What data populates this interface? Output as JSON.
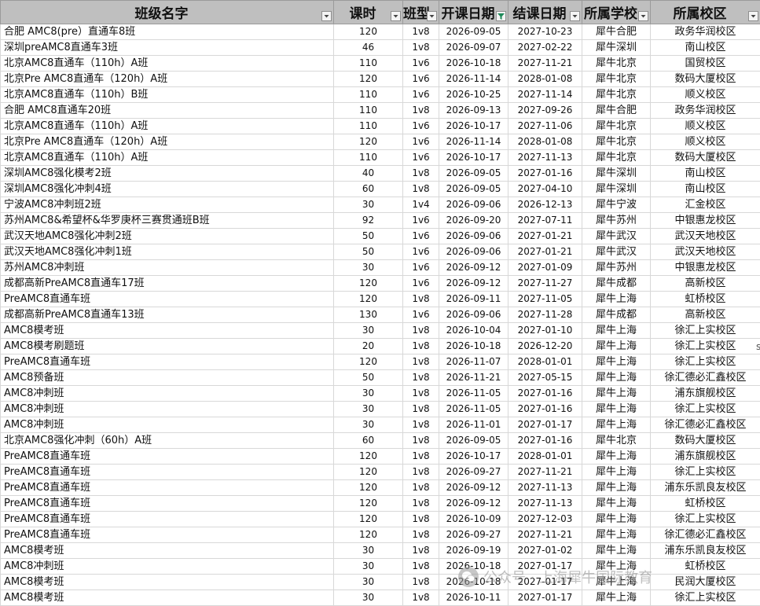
{
  "headers": [
    "班级名字",
    "课时",
    "班型",
    "开课日期",
    "结课日期",
    "所属学校",
    "所属校区"
  ],
  "header_filter_active": [
    false,
    false,
    false,
    true,
    false,
    false,
    false
  ],
  "colors": {
    "header_bg": "#bfbfbf",
    "grid": "#d8d8d8",
    "filter_active": "#1f8a5a"
  },
  "rows": [
    [
      "合肥 AMC8(pre）直通车8班",
      "120",
      "1v8",
      "2026-09-05",
      "2027-10-23",
      "犀牛合肥",
      "政务华润校区"
    ],
    [
      "深圳preAMC8直通车3班",
      "46",
      "1v8",
      "2026-09-07",
      "2027-02-22",
      "犀牛深圳",
      "南山校区"
    ],
    [
      "北京AMC8直通车（110h）A班",
      "110",
      "1v6",
      "2026-10-18",
      "2027-11-21",
      "犀牛北京",
      "国贸校区"
    ],
    [
      "北京Pre AMC8直通车（120h）A班",
      "120",
      "1v6",
      "2026-11-14",
      "2028-01-08",
      "犀牛北京",
      "数码大厦校区"
    ],
    [
      "北京AMC8直通车（110h）B班",
      "110",
      "1v6",
      "2026-10-25",
      "2027-11-14",
      "犀牛北京",
      "顺义校区"
    ],
    [
      "合肥 AMC8直通车20班",
      "110",
      "1v8",
      "2026-09-13",
      "2027-09-26",
      "犀牛合肥",
      "政务华润校区"
    ],
    [
      "北京AMC8直通车（110h）A班",
      "110",
      "1v6",
      "2026-10-17",
      "2027-11-06",
      "犀牛北京",
      "顺义校区"
    ],
    [
      "北京Pre AMC8直通车（120h）A班",
      "120",
      "1v6",
      "2026-11-14",
      "2028-01-08",
      "犀牛北京",
      "顺义校区"
    ],
    [
      "北京AMC8直通车（110h）A班",
      "110",
      "1v6",
      "2026-10-17",
      "2027-11-13",
      "犀牛北京",
      "数码大厦校区"
    ],
    [
      "深圳AMC8强化模考2班",
      "40",
      "1v8",
      "2026-09-05",
      "2027-01-16",
      "犀牛深圳",
      "南山校区"
    ],
    [
      "深圳AMC8强化冲刺4班",
      "60",
      "1v8",
      "2026-09-05",
      "2027-04-10",
      "犀牛深圳",
      "南山校区"
    ],
    [
      "宁波AMC8冲刺班2班",
      "30",
      "1v4",
      "2026-09-06",
      "2026-12-13",
      "犀牛宁波",
      "汇金校区"
    ],
    [
      "苏州AMC8&希望杯&华罗庚杯三赛贯通班B班",
      "92",
      "1v6",
      "2026-09-20",
      "2027-07-11",
      "犀牛苏州",
      "中银惠龙校区"
    ],
    [
      "武汉天地AMC8强化冲刺2班",
      "50",
      "1v6",
      "2026-09-06",
      "2027-01-21",
      "犀牛武汉",
      "武汉天地校区"
    ],
    [
      "武汉天地AMC8强化冲刺1班",
      "50",
      "1v6",
      "2026-09-06",
      "2027-01-21",
      "犀牛武汉",
      "武汉天地校区"
    ],
    [
      "苏州AMC8冲刺班",
      "30",
      "1v6",
      "2026-09-12",
      "2027-01-09",
      "犀牛苏州",
      "中银惠龙校区"
    ],
    [
      "成都高新PreAMC8直通车17班",
      "120",
      "1v6",
      "2026-09-12",
      "2027-11-27",
      "犀牛成都",
      "高新校区"
    ],
    [
      "PreAMC8直通车班",
      "120",
      "1v8",
      "2026-09-11",
      "2027-11-05",
      "犀牛上海",
      "虹桥校区"
    ],
    [
      "成都高新PreAMC8直通车13班",
      "130",
      "1v6",
      "2026-09-06",
      "2027-11-28",
      "犀牛成都",
      "高新校区"
    ],
    [
      "AMC8模考班",
      "30",
      "1v8",
      "2026-10-04",
      "2027-01-10",
      "犀牛上海",
      "徐汇上实校区"
    ],
    [
      "AMC8模考刷题班",
      "20",
      "1v8",
      "2026-10-18",
      "2026-12-20",
      "犀牛上海",
      "徐汇上实校区"
    ],
    [
      "PreAMC8直通车班",
      "120",
      "1v8",
      "2026-11-07",
      "2028-01-01",
      "犀牛上海",
      "徐汇上实校区"
    ],
    [
      "AMC8预备班",
      "50",
      "1v8",
      "2026-11-21",
      "2027-05-15",
      "犀牛上海",
      "徐汇德必汇鑫校区"
    ],
    [
      "AMC8冲刺班",
      "30",
      "1v8",
      "2026-11-05",
      "2027-01-16",
      "犀牛上海",
      "浦东旗舰校区"
    ],
    [
      "AMC8冲刺班",
      "30",
      "1v8",
      "2026-11-05",
      "2027-01-16",
      "犀牛上海",
      "徐汇上实校区"
    ],
    [
      "AMC8冲刺班",
      "30",
      "1v8",
      "2026-11-01",
      "2027-01-17",
      "犀牛上海",
      "徐汇德必汇鑫校区"
    ],
    [
      "北京AMC8强化冲刺（60h）A班",
      "60",
      "1v8",
      "2026-09-05",
      "2027-01-16",
      "犀牛北京",
      "数码大厦校区"
    ],
    [
      "PreAMC8直通车班",
      "120",
      "1v8",
      "2026-10-17",
      "2028-01-01",
      "犀牛上海",
      "浦东旗舰校区"
    ],
    [
      "PreAMC8直通车班",
      "120",
      "1v8",
      "2026-09-27",
      "2027-11-21",
      "犀牛上海",
      "徐汇上实校区"
    ],
    [
      "PreAMC8直通车班",
      "120",
      "1v8",
      "2026-09-12",
      "2027-11-13",
      "犀牛上海",
      "浦东乐凯良友校区"
    ],
    [
      "PreAMC8直通车班",
      "120",
      "1v8",
      "2026-09-12",
      "2027-11-13",
      "犀牛上海",
      "虹桥校区"
    ],
    [
      "PreAMC8直通车班",
      "120",
      "1v8",
      "2026-10-09",
      "2027-12-03",
      "犀牛上海",
      "徐汇上实校区"
    ],
    [
      "PreAMC8直通车班",
      "120",
      "1v8",
      "2026-09-27",
      "2027-11-21",
      "犀牛上海",
      "徐汇德必汇鑫校区"
    ],
    [
      "AMC8模考班",
      "30",
      "1v8",
      "2026-09-19",
      "2027-01-02",
      "犀牛上海",
      "浦东乐凯良友校区"
    ],
    [
      "AMC8冲刺班",
      "30",
      "1v8",
      "2026-10-18",
      "2027-01-17",
      "犀牛上海",
      "虹桥校区"
    ],
    [
      "AMC8模考班",
      "30",
      "1v8",
      "2026-10-18",
      "2027-01-17",
      "犀牛上海",
      "民润大厦校区"
    ],
    [
      "AMC8模考班",
      "30",
      "1v8",
      "2026-10-11",
      "2027-01-17",
      "犀牛上海",
      "徐汇上实校区"
    ]
  ],
  "watermark": {
    "text": "公众号 · 上海犀牛国际教育",
    "icon": "wechat-icon"
  },
  "stray_mark": "s"
}
